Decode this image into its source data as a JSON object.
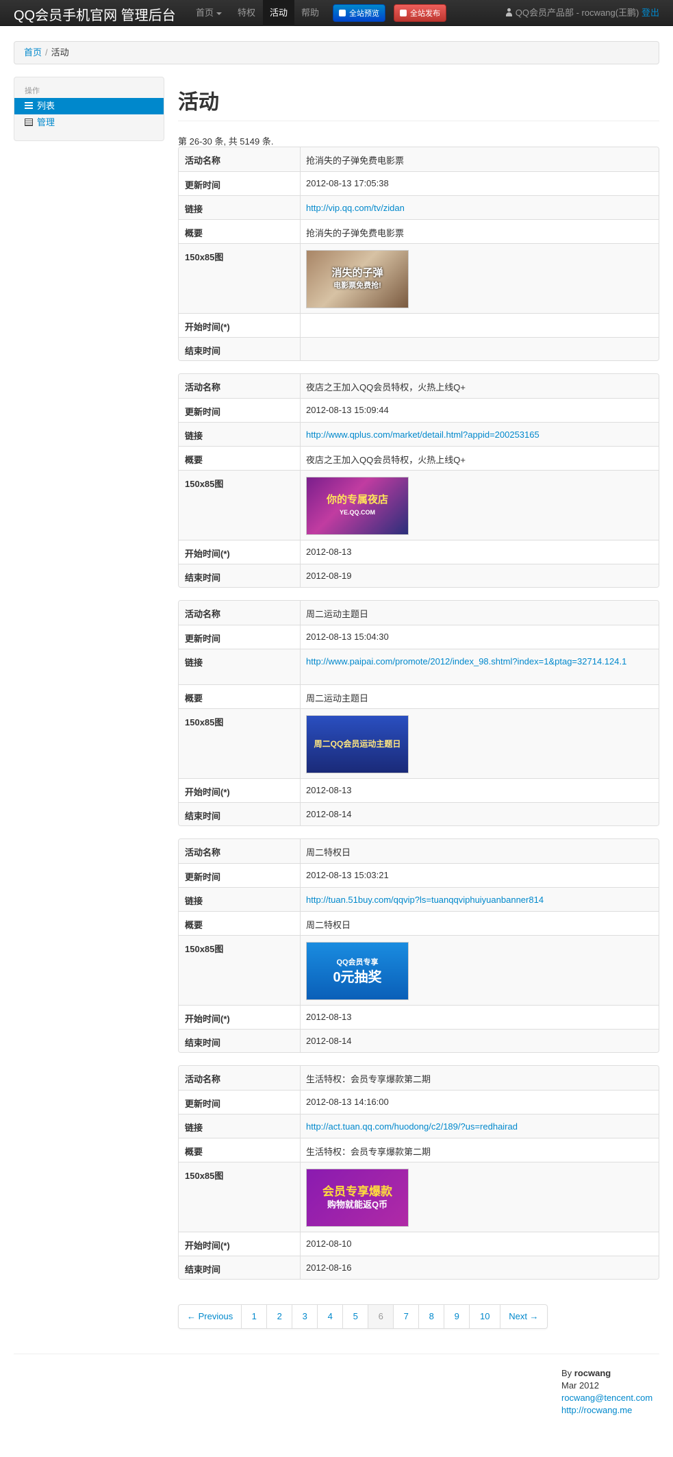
{
  "nav": {
    "brand": "QQ会员手机官网 管理后台",
    "items": [
      {
        "label": "首页"
      },
      {
        "label": "特权"
      },
      {
        "label": "活动"
      },
      {
        "label": "帮助"
      }
    ],
    "preview_button": "全站预览",
    "publish_button": "全站发布",
    "user_text": "QQ会员产品部 - rocwang(王鹏)",
    "logout": "登出"
  },
  "breadcrumb": {
    "home": "首页",
    "divider": "/",
    "current": "活动"
  },
  "sidebar": {
    "header": "操作",
    "items": [
      {
        "label": "列表"
      },
      {
        "label": "管理"
      }
    ]
  },
  "main": {
    "title": "活动",
    "summary": "第 26-30 条, 共 5149 条."
  },
  "field_labels": {
    "name": "活动名称",
    "updated": "更新时间",
    "link": "链接",
    "summary": "概要",
    "image": "150x85图",
    "start": "开始时间(*)",
    "end": "结束时间"
  },
  "activities": [
    {
      "name": "抢消失的子弹免费电影票",
      "updated": "2012-08-13 17:05:38",
      "link": "http://vip.qq.com/tv/zidan",
      "summary": "抢消失的子弹免费电影票",
      "image_text": "消失的子弹",
      "image_subtext": "电影票免费抢!",
      "start": "",
      "end": ""
    },
    {
      "name": "夜店之王加入QQ会员特权，火热上线Q+",
      "updated": "2012-08-13 15:09:44",
      "link": "http://www.qplus.com/market/detail.html?appid=200253165",
      "summary": "夜店之王加入QQ会员特权，火热上线Q+",
      "image_text": "你的专属夜店",
      "image_subtext": "YE.QQ.COM",
      "start": "2012-08-13",
      "end": "2012-08-19"
    },
    {
      "name": "周二运动主题日",
      "updated": "2012-08-13 15:04:30",
      "link": "http://www.paipai.com/promote/2012/index_98.shtml?index=1&ptag=32714.124.1",
      "summary": "周二运动主题日",
      "image_text": "周二QQ会员运动主题日",
      "image_subtext": "",
      "start": "2012-08-13",
      "end": "2012-08-14"
    },
    {
      "name": "周二特权日",
      "updated": "2012-08-13 15:03:21",
      "link": "http://tuan.51buy.com/qqvip?ls=tuanqqviphuiyuanbanner814",
      "summary": "周二特权日",
      "image_text": "0元抽奖",
      "image_subtext": "QQ会员专享",
      "start": "2012-08-13",
      "end": "2012-08-14"
    },
    {
      "name": "生活特权：会员专享爆款第二期",
      "updated": "2012-08-13 14:16:00",
      "link": "http://act.tuan.qq.com/huodong/c2/189/?us=redhairad",
      "summary": "生活特权：会员专享爆款第二期",
      "image_text": "会员专享爆款",
      "image_subtext": "购物就能返Q币",
      "start": "2012-08-10",
      "end": "2012-08-16"
    }
  ],
  "pagination": {
    "previous": "← Previous",
    "pages": [
      "1",
      "2",
      "3",
      "4",
      "5",
      "6",
      "7",
      "8",
      "9",
      "10"
    ],
    "current": "6",
    "next": "Next →"
  },
  "footer": {
    "by": "By",
    "author": "rocwang",
    "date": "Mar 2012",
    "email": "rocwang@tencent.com",
    "site": "http://rocwang.me"
  }
}
